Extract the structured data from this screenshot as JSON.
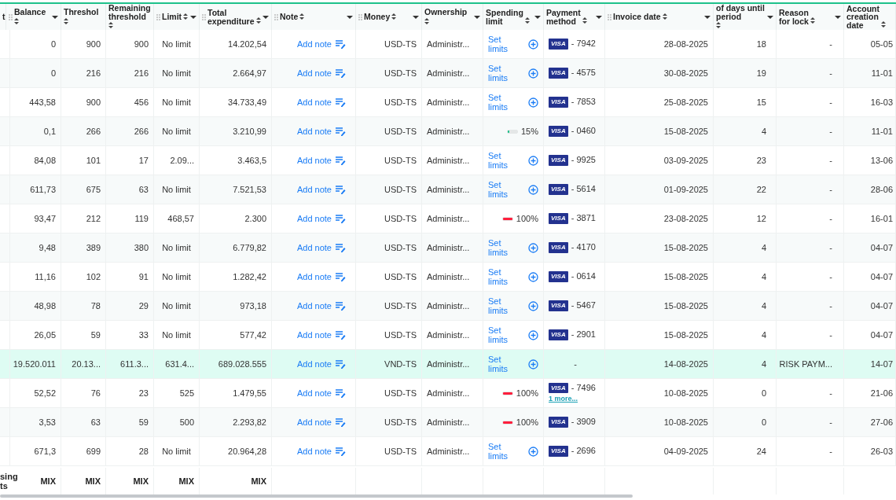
{
  "table": {
    "columns": [
      {
        "label": "t"
      },
      {
        "label": "Balance",
        "sortable": true,
        "menu": true,
        "handle": true
      },
      {
        "label": "Threshol",
        "sortable": true,
        "menu": false,
        "handle": false
      },
      {
        "label": "Remaining threshold",
        "sortable": true,
        "menu": false,
        "handle": false
      },
      {
        "label": "Limit",
        "sortable": true,
        "menu": true,
        "handle": true
      },
      {
        "label": "Total expenditure",
        "sortable": true,
        "menu": true,
        "handle": true
      },
      {
        "label": "Note",
        "sortable": true,
        "menu": true,
        "handle": true
      },
      {
        "label": "Money",
        "sortable": true,
        "menu": true,
        "handle": true
      },
      {
        "label": "Ownership",
        "sortable": true,
        "menu": true,
        "handle": false
      },
      {
        "label": "Spending limit",
        "sortable": true,
        "menu": true,
        "handle": false
      },
      {
        "label": "Payment method",
        "sortable": true,
        "menu": true,
        "handle": false
      },
      {
        "label": "Invoice date",
        "sortable": true,
        "menu": true,
        "handle": true
      },
      {
        "label": "of days until period",
        "sortable": true,
        "menu": true,
        "handle": false
      },
      {
        "label": "Reason for lock",
        "sortable": true,
        "menu": true,
        "handle": false
      },
      {
        "label": "Account creation date",
        "sortable": true,
        "menu": false,
        "handle": false
      }
    ],
    "rows": [
      {
        "selected": false,
        "balance": "0",
        "threshold": "900",
        "remaining_threshold": "900",
        "limit": "No limit",
        "total_expenditure": "14.202,54",
        "note": "Add note",
        "money": "USD-TS",
        "ownership": "Administr...",
        "spending_limit": {
          "kind": "set",
          "label": "Set limits"
        },
        "payment_method": {
          "brand": "VISA",
          "number": "- 7942"
        },
        "invoice_date": "28-08-2025",
        "days_until_period": "18",
        "reason_for_lock": "-",
        "account_creation_date": "05-05"
      },
      {
        "selected": false,
        "balance": "0",
        "threshold": "216",
        "remaining_threshold": "216",
        "limit": "No limit",
        "total_expenditure": "2.664,97",
        "note": "Add note",
        "money": "USD-TS",
        "ownership": "Administr...",
        "spending_limit": {
          "kind": "set",
          "label": "Set limits"
        },
        "payment_method": {
          "brand": "VISA",
          "number": "- 4575"
        },
        "invoice_date": "30-08-2025",
        "days_until_period": "19",
        "reason_for_lock": "-",
        "account_creation_date": "11-01"
      },
      {
        "selected": false,
        "balance": "443,58",
        "threshold": "900",
        "remaining_threshold": "456",
        "limit": "No limit",
        "total_expenditure": "34.733,49",
        "note": "Add note",
        "money": "USD-TS",
        "ownership": "Administr...",
        "spending_limit": {
          "kind": "set",
          "label": "Set limits"
        },
        "payment_method": {
          "brand": "VISA",
          "number": "- 7853"
        },
        "invoice_date": "25-08-2025",
        "days_until_period": "15",
        "reason_for_lock": "-",
        "account_creation_date": "16-03"
      },
      {
        "selected": false,
        "balance": "0,1",
        "threshold": "266",
        "remaining_threshold": "266",
        "limit": "No limit",
        "total_expenditure": "3.210,99",
        "note": "Add note",
        "money": "USD-TS",
        "ownership": "Administr...",
        "spending_limit": {
          "kind": "progress",
          "level": 0.15,
          "reading": "15%"
        },
        "payment_method": {
          "brand": "VISA",
          "number": "- 0460"
        },
        "invoice_date": "15-08-2025",
        "days_until_period": "4",
        "reason_for_lock": "-",
        "account_creation_date": "11-01"
      },
      {
        "selected": false,
        "balance": "84,08",
        "threshold": "101",
        "remaining_threshold": "17",
        "limit": "2.09...",
        "total_expenditure": "3.463,5",
        "note": "Add note",
        "money": "USD-TS",
        "ownership": "Administr...",
        "spending_limit": {
          "kind": "set",
          "label": "Set limits"
        },
        "payment_method": {
          "brand": "VISA",
          "number": "- 9925"
        },
        "invoice_date": "03-09-2025",
        "days_until_period": "23",
        "reason_for_lock": "-",
        "account_creation_date": "13-06"
      },
      {
        "selected": false,
        "balance": "611,73",
        "threshold": "675",
        "remaining_threshold": "63",
        "limit": "No limit",
        "total_expenditure": "7.521,53",
        "note": "Add note",
        "money": "USD-TS",
        "ownership": "Administr...",
        "spending_limit": {
          "kind": "set",
          "label": "Set limits"
        },
        "payment_method": {
          "brand": "VISA",
          "number": "- 5614"
        },
        "invoice_date": "01-09-2025",
        "days_until_period": "22",
        "reason_for_lock": "-",
        "account_creation_date": "28-06"
      },
      {
        "selected": false,
        "balance": "93,47",
        "threshold": "212",
        "remaining_threshold": "119",
        "limit": "468,57",
        "total_expenditure": "2.300",
        "note": "Add note",
        "money": "USD-TS",
        "ownership": "Administr...",
        "spending_limit": {
          "kind": "progress",
          "level": 1,
          "reading": "100%"
        },
        "payment_method": {
          "brand": "VISA",
          "number": "- 3871"
        },
        "invoice_date": "23-08-2025",
        "days_until_period": "12",
        "reason_for_lock": "-",
        "account_creation_date": "16-01"
      },
      {
        "selected": false,
        "balance": "9,48",
        "threshold": "389",
        "remaining_threshold": "380",
        "limit": "No limit",
        "total_expenditure": "6.779,82",
        "note": "Add note",
        "money": "USD-TS",
        "ownership": "Administr...",
        "spending_limit": {
          "kind": "set",
          "label": "Set limits"
        },
        "payment_method": {
          "brand": "VISA",
          "number": "- 4170"
        },
        "invoice_date": "15-08-2025",
        "days_until_period": "4",
        "reason_for_lock": "-",
        "account_creation_date": "04-07"
      },
      {
        "selected": false,
        "balance": "11,16",
        "threshold": "102",
        "remaining_threshold": "91",
        "limit": "No limit",
        "total_expenditure": "1.282,42",
        "note": "Add note",
        "money": "USD-TS",
        "ownership": "Administr...",
        "spending_limit": {
          "kind": "set",
          "label": "Set limits"
        },
        "payment_method": {
          "brand": "VISA",
          "number": "- 0614"
        },
        "invoice_date": "15-08-2025",
        "days_until_period": "4",
        "reason_for_lock": "-",
        "account_creation_date": "04-07"
      },
      {
        "selected": false,
        "balance": "48,98",
        "threshold": "78",
        "remaining_threshold": "29",
        "limit": "No limit",
        "total_expenditure": "973,18",
        "note": "Add note",
        "money": "USD-TS",
        "ownership": "Administr...",
        "spending_limit": {
          "kind": "set",
          "label": "Set limits"
        },
        "payment_method": {
          "brand": "VISA",
          "number": "- 5467"
        },
        "invoice_date": "15-08-2025",
        "days_until_period": "4",
        "reason_for_lock": "-",
        "account_creation_date": "04-07"
      },
      {
        "selected": false,
        "balance": "26,05",
        "threshold": "59",
        "remaining_threshold": "33",
        "limit": "No limit",
        "total_expenditure": "577,42",
        "note": "Add note",
        "money": "USD-TS",
        "ownership": "Administr...",
        "spending_limit": {
          "kind": "set",
          "label": "Set limits"
        },
        "payment_method": {
          "brand": "VISA",
          "number": "- 2901"
        },
        "invoice_date": "15-08-2025",
        "days_until_period": "4",
        "reason_for_lock": "-",
        "account_creation_date": "04-07"
      },
      {
        "selected": true,
        "balance": "19.520.011",
        "threshold": "20.13...",
        "remaining_threshold": "611.3...",
        "limit": "631.4...",
        "total_expenditure": "689.028.555",
        "note": "Add note",
        "money": "VND-TS",
        "ownership": "Administr...",
        "spending_limit": {
          "kind": "set",
          "label": "Set limits"
        },
        "payment_method": {
          "text": "-"
        },
        "invoice_date": "14-08-2025",
        "days_until_period": "4",
        "reason_for_lock": "RISK PAYM...",
        "account_creation_date": "14-07"
      },
      {
        "selected": false,
        "balance": "52,52",
        "threshold": "76",
        "remaining_threshold": "23",
        "limit": "525",
        "total_expenditure": "1.479,55",
        "note": "Add note",
        "money": "USD-TS",
        "ownership": "Administr...",
        "spending_limit": {
          "kind": "progress",
          "level": 1,
          "reading": "100%"
        },
        "payment_method": {
          "brand": "VISA",
          "number": "- 7496",
          "more": "1 more..."
        },
        "invoice_date": "10-08-2025",
        "days_until_period": "0",
        "reason_for_lock": "-",
        "account_creation_date": "21-06"
      },
      {
        "selected": false,
        "balance": "3,53",
        "threshold": "63",
        "remaining_threshold": "59",
        "limit": "500",
        "total_expenditure": "2.293,82",
        "note": "Add note",
        "money": "USD-TS",
        "ownership": "Administr...",
        "spending_limit": {
          "kind": "progress",
          "level": 1,
          "reading": "100%"
        },
        "payment_method": {
          "brand": "VISA",
          "number": "- 3909"
        },
        "invoice_date": "10-08-2025",
        "days_until_period": "0",
        "reason_for_lock": "-",
        "account_creation_date": "27-06"
      },
      {
        "selected": false,
        "balance": "671,3",
        "threshold": "699",
        "remaining_threshold": "28",
        "limit": "No limit",
        "total_expenditure": "20.964,28",
        "note": "Add note",
        "money": "USD-TS",
        "ownership": "Administr...",
        "spending_limit": {
          "kind": "set",
          "label": "Set limits"
        },
        "payment_method": {
          "brand": "VISA",
          "number": "- 2696"
        },
        "invoice_date": "04-09-2025",
        "days_until_period": "24",
        "reason_for_lock": "-",
        "account_creation_date": "26-03"
      }
    ],
    "footer": [
      "sing ts",
      "MIX",
      "MIX",
      "MIX",
      "MIX",
      "MIX"
    ]
  }
}
